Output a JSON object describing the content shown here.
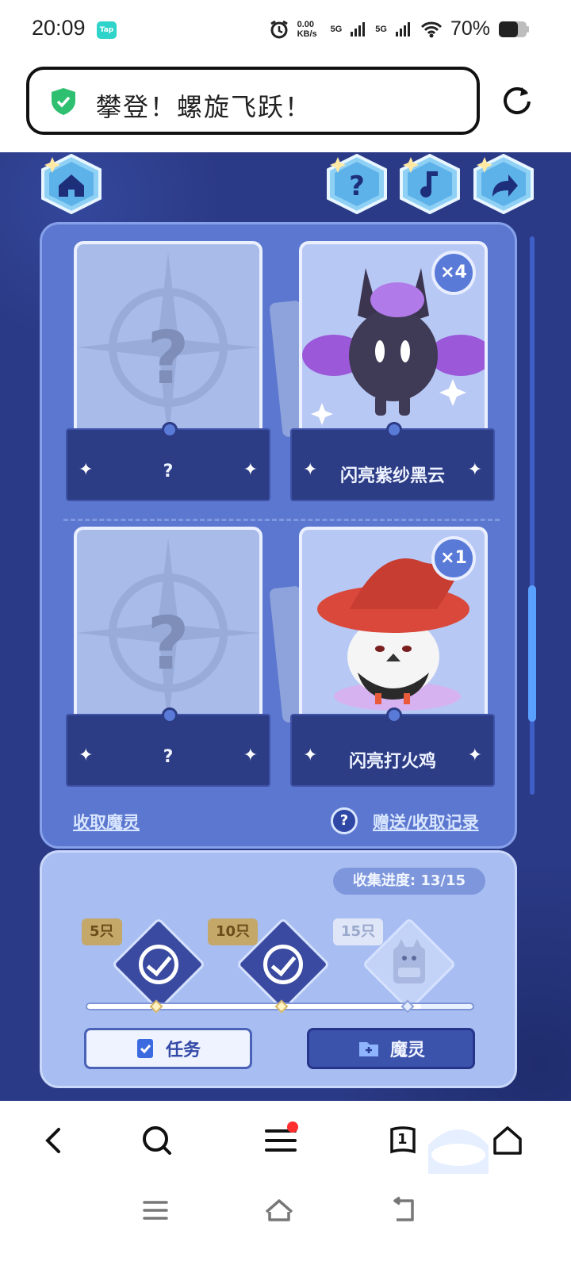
{
  "status_bar": {
    "time": "20:09",
    "app_badge": "Tap",
    "net_speed": "0.00 KB/s",
    "signal_1": "5G",
    "signal_2": "5G",
    "battery": "70%"
  },
  "address_bar": {
    "title": "攀登！螺旋飞跃！",
    "secure_icon": "shield-check-icon",
    "reload_icon": "reload-icon"
  },
  "game": {
    "top_icons": [
      "home-icon",
      "help-icon",
      "music-icon",
      "share-icon"
    ],
    "cards": [
      {
        "name": "?",
        "count": "",
        "unlocked": false
      },
      {
        "name": "闪亮紫纱黑云",
        "count": "×4",
        "unlocked": true
      },
      {
        "name": "?",
        "count": "",
        "unlocked": false
      },
      {
        "name": "闪亮打火鸡",
        "count": "×1",
        "unlocked": true
      }
    ],
    "collect_link": "收取魔灵",
    "help_mark": "?",
    "records_link": "赠送/收取记录",
    "progress_label": "收集进度: 13/15",
    "progress_fraction": 0.867,
    "milestones": [
      {
        "label": "5只",
        "done": true
      },
      {
        "label": "10只",
        "done": true
      },
      {
        "label": "15只",
        "done": false
      }
    ],
    "task_button": "任务",
    "spirit_button": "魔灵"
  },
  "colors": {
    "accent": "#3c53ac",
    "panel": "#5b77cf",
    "background": "#2b3a86",
    "notification_dot": "#ff2d2d",
    "secure_green": "#2fbf71"
  },
  "bottom_nav": {
    "items": [
      "back-icon",
      "search-icon",
      "menu-icon",
      "tabs-icon",
      "home-icon"
    ],
    "tab_count": "1"
  },
  "system_nav": [
    "recent-apps-icon",
    "home-icon",
    "back-icon"
  ]
}
